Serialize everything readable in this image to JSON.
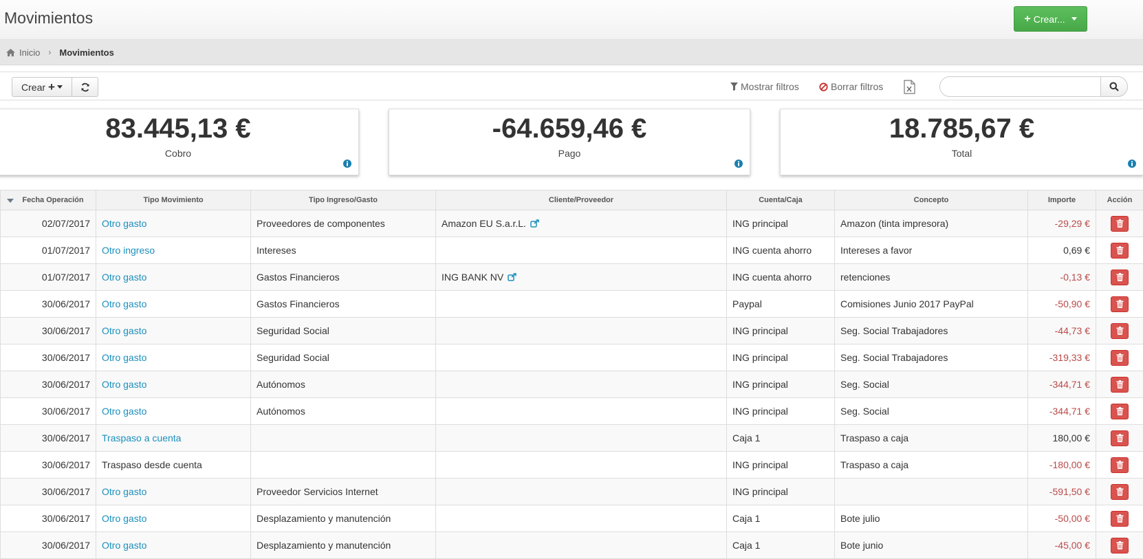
{
  "header": {
    "title": "Movimientos",
    "create_label": "Crear...",
    "create_color": "#4cae4c"
  },
  "breadcrumb": {
    "home": "Inicio",
    "current": "Movimientos"
  },
  "toolbar": {
    "crear_label": "Crear",
    "show_filters": "Mostrar filtros",
    "clear_filters": "Borrar filtros",
    "search_placeholder": ""
  },
  "summary": [
    {
      "amount": "83.445,13 €",
      "label": "Cobro"
    },
    {
      "amount": "-64.659,46 €",
      "label": "Pago"
    },
    {
      "amount": "18.785,67 €",
      "label": "Total"
    }
  ],
  "table": {
    "columns": [
      "Fecha Operación",
      "Tipo Movimiento",
      "Tipo Ingreso/Gasto",
      "Cliente/Proveedor",
      "Cuenta/Caja",
      "Concepto",
      "Importe",
      "Acción"
    ],
    "rows": [
      {
        "fecha": "02/07/2017",
        "tipo": "Otro gasto",
        "tipo_link": true,
        "ingreso_gasto": "Proveedores de componentes",
        "cliente": "Amazon EU S.a.r.L.",
        "cliente_link": true,
        "cuenta": "ING principal",
        "concepto": "Amazon (tinta impresora)",
        "importe": "-29,29 €",
        "neg": true
      },
      {
        "fecha": "01/07/2017",
        "tipo": "Otro ingreso",
        "tipo_link": true,
        "ingreso_gasto": "Intereses",
        "cliente": "",
        "cliente_link": false,
        "cuenta": "ING cuenta ahorro",
        "concepto": "Intereses a favor",
        "importe": "0,69 €",
        "neg": false
      },
      {
        "fecha": "01/07/2017",
        "tipo": "Otro gasto",
        "tipo_link": true,
        "ingreso_gasto": "Gastos Financieros",
        "cliente": "ING BANK NV",
        "cliente_link": true,
        "cuenta": "ING cuenta ahorro",
        "concepto": "retenciones",
        "importe": "-0,13 €",
        "neg": true
      },
      {
        "fecha": "30/06/2017",
        "tipo": "Otro gasto",
        "tipo_link": true,
        "ingreso_gasto": "Gastos Financieros",
        "cliente": "",
        "cliente_link": false,
        "cuenta": "Paypal",
        "concepto": "Comisiones Junio 2017 PayPal",
        "importe": "-50,90 €",
        "neg": true
      },
      {
        "fecha": "30/06/2017",
        "tipo": "Otro gasto",
        "tipo_link": true,
        "ingreso_gasto": "Seguridad Social",
        "cliente": "",
        "cliente_link": false,
        "cuenta": "ING principal",
        "concepto": "Seg. Social Trabajadores",
        "importe": "-44,73 €",
        "neg": true
      },
      {
        "fecha": "30/06/2017",
        "tipo": "Otro gasto",
        "tipo_link": true,
        "ingreso_gasto": "Seguridad Social",
        "cliente": "",
        "cliente_link": false,
        "cuenta": "ING principal",
        "concepto": "Seg. Social Trabajadores",
        "importe": "-319,33 €",
        "neg": true
      },
      {
        "fecha": "30/06/2017",
        "tipo": "Otro gasto",
        "tipo_link": true,
        "ingreso_gasto": "Autónomos",
        "cliente": "",
        "cliente_link": false,
        "cuenta": "ING principal",
        "concepto": "Seg. Social",
        "importe": "-344,71 €",
        "neg": true
      },
      {
        "fecha": "30/06/2017",
        "tipo": "Otro gasto",
        "tipo_link": true,
        "ingreso_gasto": "Autónomos",
        "cliente": "",
        "cliente_link": false,
        "cuenta": "ING principal",
        "concepto": "Seg. Social",
        "importe": "-344,71 €",
        "neg": true
      },
      {
        "fecha": "30/06/2017",
        "tipo": "Traspaso a cuenta",
        "tipo_link": true,
        "ingreso_gasto": "",
        "cliente": "",
        "cliente_link": false,
        "cuenta": "Caja 1",
        "concepto": "Traspaso a caja",
        "importe": "180,00 €",
        "neg": false
      },
      {
        "fecha": "30/06/2017",
        "tipo": "Traspaso desde cuenta",
        "tipo_link": false,
        "ingreso_gasto": "",
        "cliente": "",
        "cliente_link": false,
        "cuenta": "ING principal",
        "concepto": "Traspaso a caja",
        "importe": "-180,00 €",
        "neg": true
      },
      {
        "fecha": "30/06/2017",
        "tipo": "Otro gasto",
        "tipo_link": true,
        "ingreso_gasto": "Proveedor Servicios Internet",
        "cliente": "",
        "cliente_link": false,
        "cuenta": "ING principal",
        "concepto": "",
        "importe": "-591,50 €",
        "neg": true
      },
      {
        "fecha": "30/06/2017",
        "tipo": "Otro gasto",
        "tipo_link": true,
        "ingreso_gasto": "Desplazamiento y manutención",
        "cliente": "",
        "cliente_link": false,
        "cuenta": "Caja 1",
        "concepto": "Bote julio",
        "importe": "-50,00 €",
        "neg": true
      },
      {
        "fecha": "30/06/2017",
        "tipo": "Otro gasto",
        "tipo_link": true,
        "ingreso_gasto": "Desplazamiento y manutención",
        "cliente": "",
        "cliente_link": false,
        "cuenta": "Caja 1",
        "concepto": "Bote junio",
        "importe": "-45,00 €",
        "neg": true
      }
    ]
  }
}
